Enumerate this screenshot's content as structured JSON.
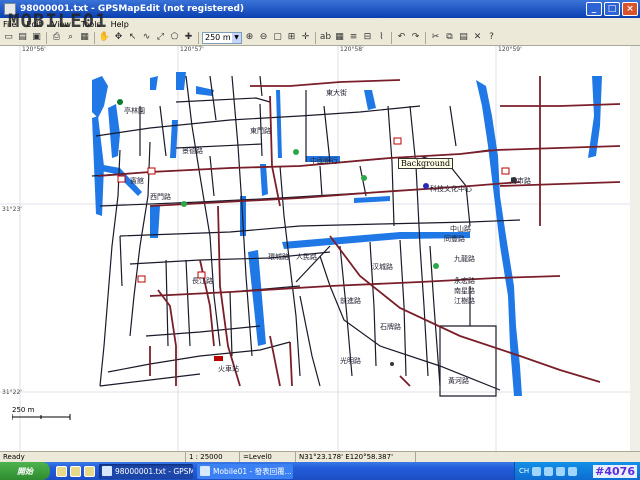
{
  "window": {
    "title": "98000001.txt - GPSMapEdit (not registered)",
    "minimize": "_",
    "maximize": "□",
    "close": "×"
  },
  "watermark": "MOBILE01",
  "menu": [
    "File",
    "Edit",
    "View",
    "Tools",
    "Help"
  ],
  "toolbar": {
    "zoom_value": "250 m"
  },
  "map": {
    "coords": {
      "lon1": "120°56'",
      "lon2": "120°57'",
      "lon3": "120°58'",
      "lon4": "120°59'",
      "lat1": "31°23'",
      "lat2": "31°22'"
    },
    "background_label": "Background",
    "scale_label": "250 m",
    "station_label": "火車站",
    "labels": {
      "l1": "亭林園",
      "l2": "賓館",
      "l3": "中國銀行",
      "l4": "科技文化中心",
      "l5": "東大街",
      "l6": "汉城路",
      "l7": "人民路",
      "l8": "前進路",
      "l9": "同豐路",
      "l10": "九龍路",
      "l11": "永宏路",
      "l12": "南星路",
      "l13": "江樹路",
      "l14": "黃河路",
      "l15": "景德路",
      "l16": "東門路",
      "l17": "西門路",
      "l18": "環城路",
      "l19": "中山路",
      "l20": "長江路",
      "l21": "光明路",
      "l22": "周市路",
      "l23": "石牌路"
    }
  },
  "status": {
    "ready": "Ready",
    "scale": "1 : 25000",
    "level": "=Level0",
    "position": "N31°23.178' E120°58.387'"
  },
  "taskbar": {
    "start": "開始",
    "task1": "98000001.txt - GPSM...",
    "task2": "Mobile01 - 發表回覆...",
    "lang": "CH",
    "badge": "#4076"
  }
}
